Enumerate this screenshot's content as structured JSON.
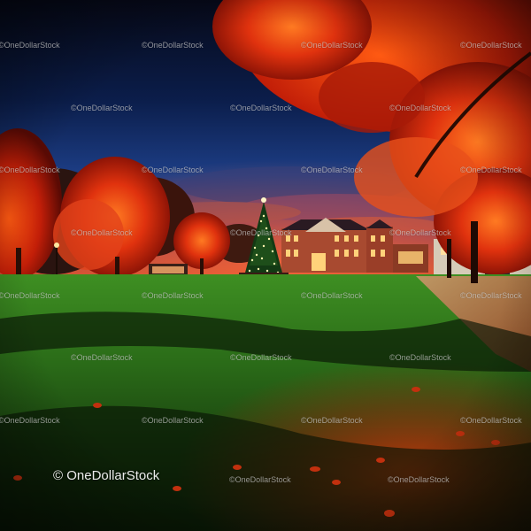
{
  "image": {
    "watermark_text": "©OneDollarStock",
    "main_watermark_text": "© OneDollarStock"
  },
  "colors": {
    "sky_top": "#070b1e",
    "sky_mid": "#12306a",
    "sky_glow": "#c23a2a",
    "foliage_red": "#d8280e",
    "foliage_orange": "#ff6a1a",
    "grass_green": "#2f7a1e",
    "grass_dark": "#0c1f08",
    "building_brick": "#b0442a",
    "window_light": "#ffd27a",
    "tree_lights": "#fff3b0"
  }
}
